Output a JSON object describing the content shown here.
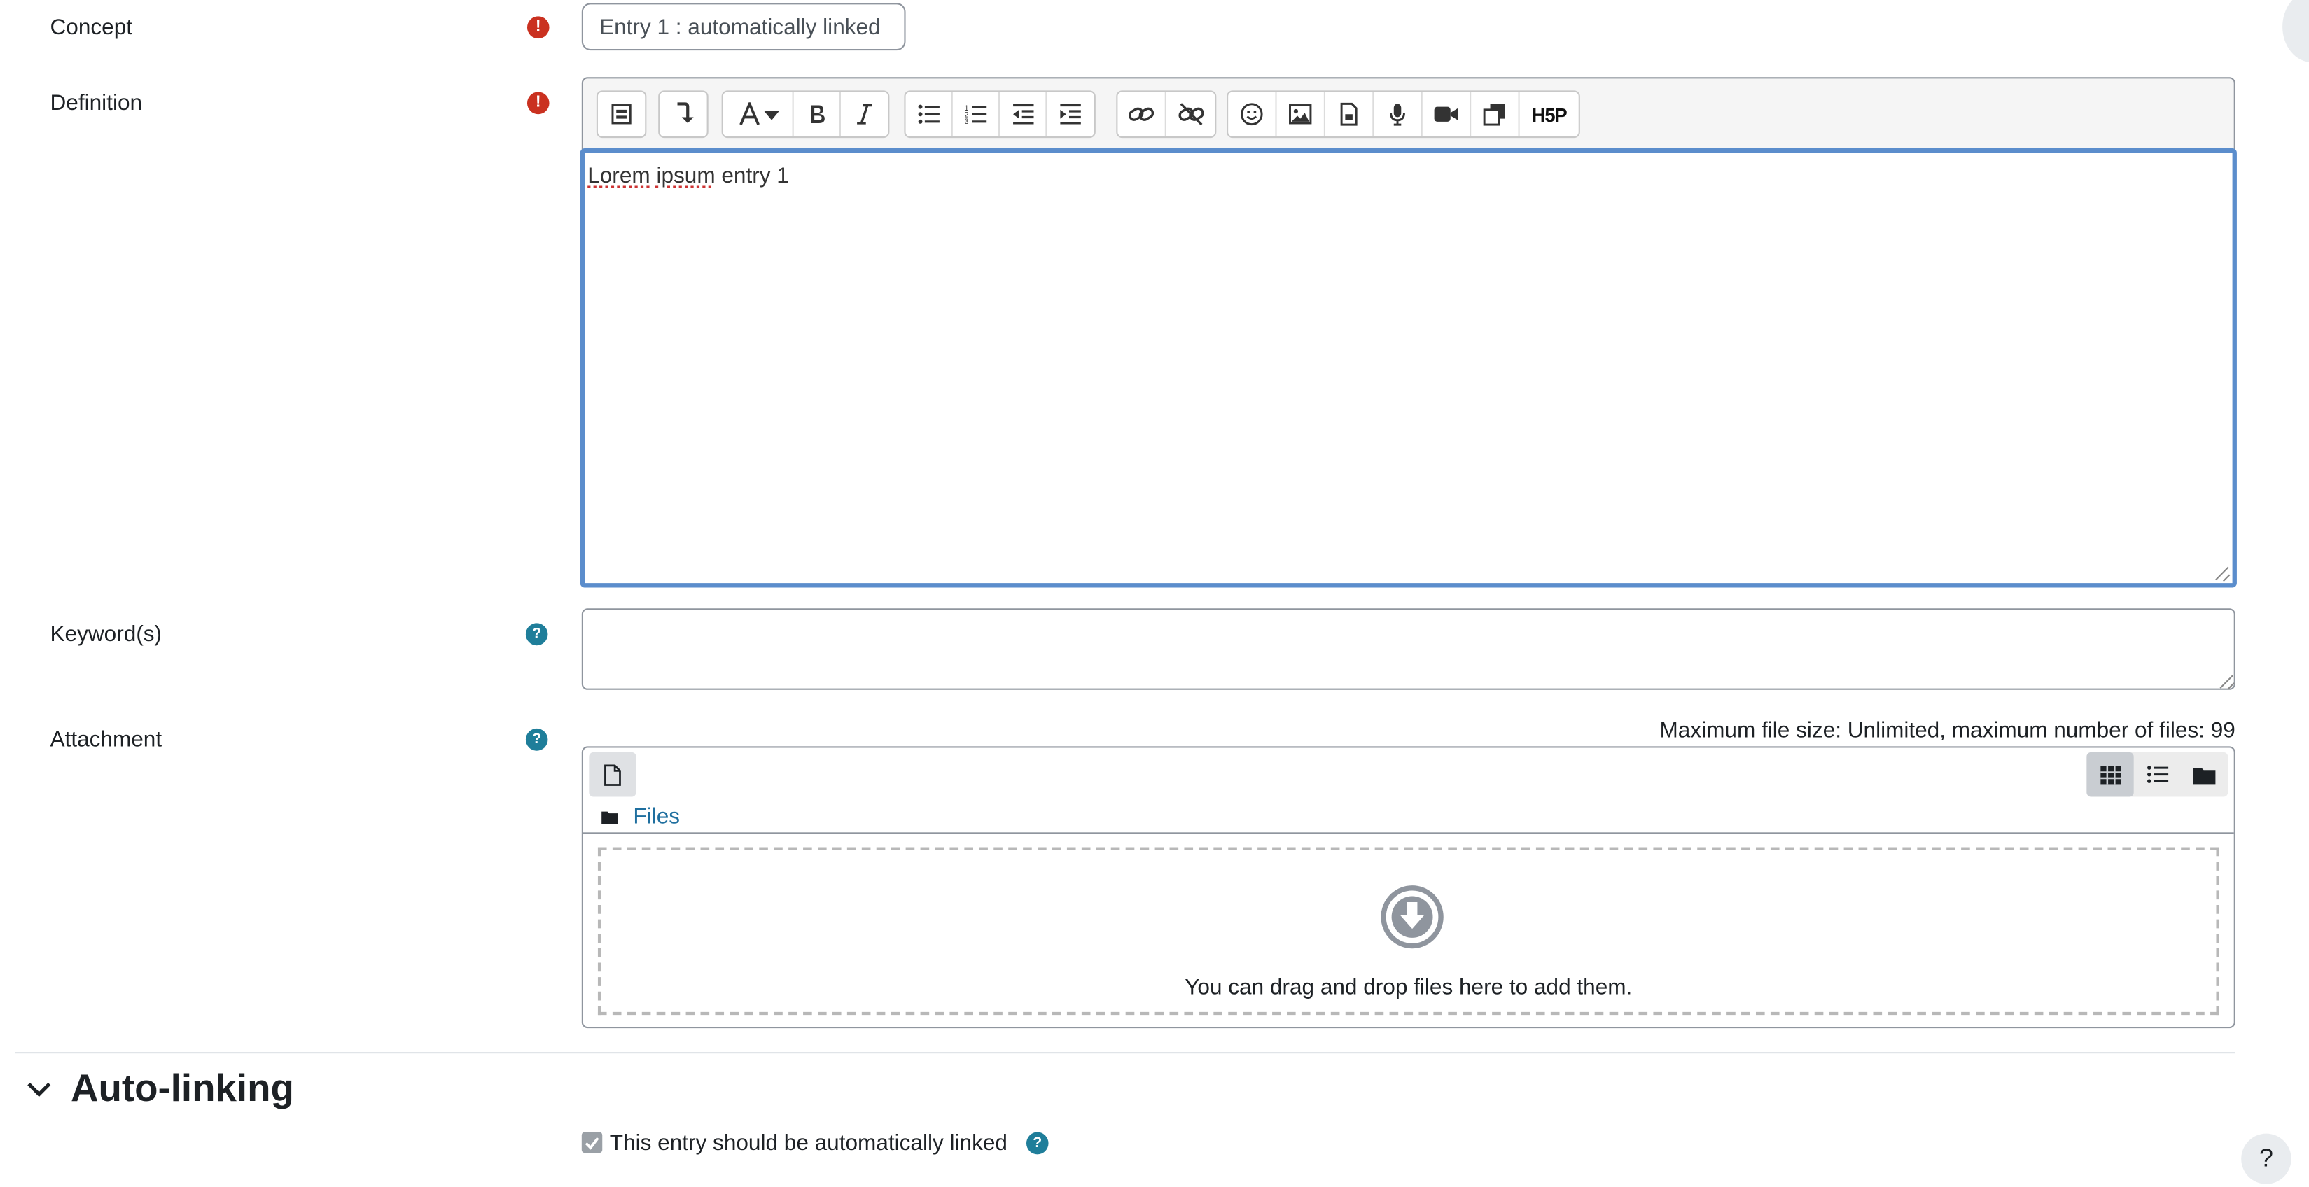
{
  "form": {
    "concept": {
      "label": "Concept",
      "value": "Entry 1 : automatically linked",
      "required_mark": "!"
    },
    "definition": {
      "label": "Definition",
      "required_mark": "!",
      "text_part1": "Lorem",
      "text_part2": "ipsum",
      "text_part3": " entry 1"
    },
    "keywords": {
      "label": "Keyword(s)",
      "help_mark": "?",
      "value": ""
    },
    "attachment": {
      "label": "Attachment",
      "help_mark": "?",
      "max_size_text": "Maximum file size: Unlimited, maximum number of files: 99",
      "path_label": "Files",
      "drop_text": "You can drag and drop files here to add them."
    }
  },
  "toolbar": {
    "buttons": [
      "show-more-buttons",
      "paragraph-style",
      "font-style",
      "bold",
      "italic",
      "unordered-list",
      "ordered-list",
      "outdent",
      "indent",
      "link",
      "unlink",
      "emoticon",
      "image",
      "media",
      "record-audio",
      "record-video",
      "manage-files",
      "h5p"
    ],
    "h5p_label": "H5P"
  },
  "autolink": {
    "section_title": "Auto-linking",
    "checkbox_label": "This entry should be automatically linked",
    "checked": true,
    "help_mark": "?"
  },
  "floating_help": "?",
  "colors": {
    "required": "#ca3120",
    "help": "#1f7e9a",
    "focus": "#5b8dcc",
    "link": "#1f6f9f"
  }
}
